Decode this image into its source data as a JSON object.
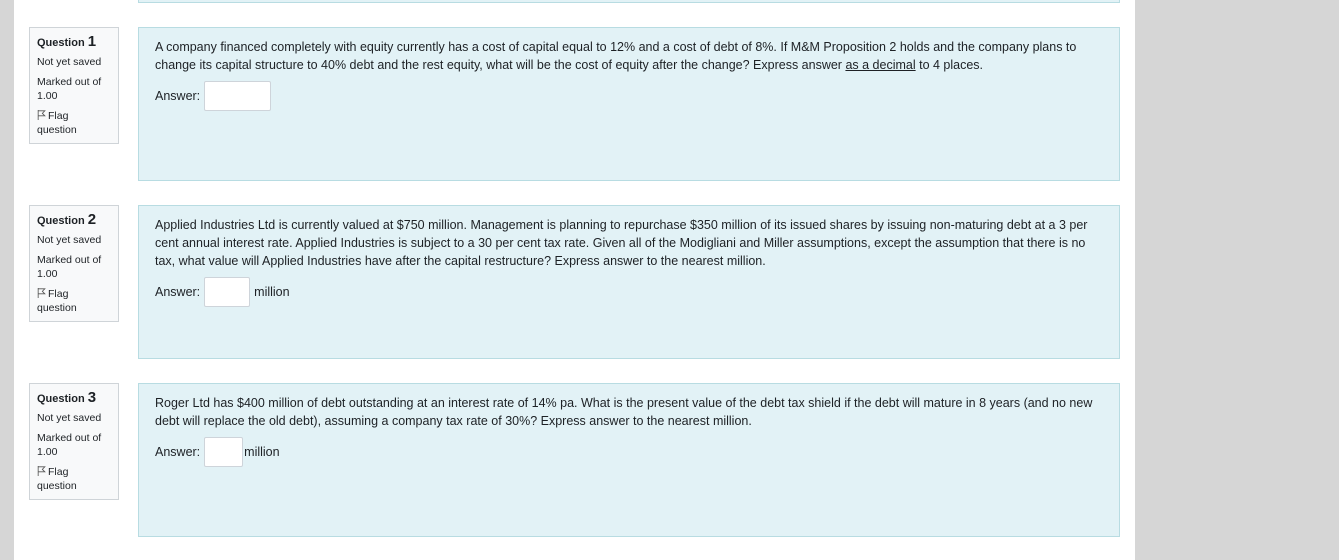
{
  "questions": [
    {
      "label": "Question",
      "number": "1",
      "state": "Not yet saved",
      "grade_line1": "Marked out of",
      "grade_line2": "1.00",
      "flag_line1": "Flag",
      "flag_line2": "question",
      "text_before": "A company financed completely with equity currently has a cost of capital equal to 12% and a cost of debt of 8%. If M&M Proposition 2 holds and the company plans to change its capital structure to 40% debt and the rest equity, what will be the cost of equity after the change? Express answer ",
      "text_underlined": "as a decimal",
      "text_after": " to 4 places.",
      "answer_label": "Answer:",
      "answer_value": "",
      "unit": ""
    },
    {
      "label": "Question",
      "number": "2",
      "state": "Not yet saved",
      "grade_line1": "Marked out of",
      "grade_line2": "1.00",
      "flag_line1": "Flag",
      "flag_line2": "question",
      "text": "Applied Industries Ltd is currently valued at $750 million. Management is planning to repurchase $350 million of its issued shares by issuing non-maturing debt at a 3 per cent annual interest rate.  Applied Industries is subject to a 30 per cent tax rate.  Given all of the Modigliani and Miller assumptions, except the assumption that there is no tax, what value will Applied Industries have after the capital restructure? Express answer to the nearest million.",
      "answer_label": "Answer:",
      "answer_value": "",
      "unit": "million"
    },
    {
      "label": "Question",
      "number": "3",
      "state": "Not yet saved",
      "grade_line1": "Marked out of",
      "grade_line2": "1.00",
      "flag_line1": "Flag",
      "flag_line2": "question",
      "text": "Roger Ltd has $400 million of debt outstanding at an interest rate of 14% pa. What is the present value of the debt tax shield if the debt will mature in 8 years (and no new debt will replace the old debt), assuming a company tax rate of 30%? Express answer to the nearest million.",
      "answer_label": "Answer:",
      "answer_value": "",
      "unit": "million"
    }
  ],
  "colors": {
    "content_bg": "#e2f2f6",
    "content_border": "#b8dce2",
    "info_bg": "#f8f9fa",
    "side_gray": "#d6d6d6"
  }
}
